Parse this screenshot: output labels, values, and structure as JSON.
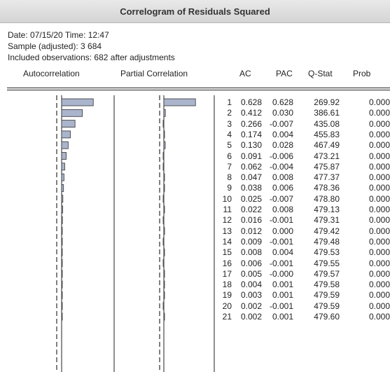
{
  "title": "Correlogram of Residuals Squared",
  "info": {
    "date_line": "Date: 07/15/20   Time: 12:47",
    "sample_line": "Sample (adjusted): 3 684",
    "obs_line": "Included observations: 682 after adjustments"
  },
  "headers": {
    "autocorrelation": "Autocorrelation",
    "partial_correlation": "Partial Correlation",
    "ac": "AC",
    "pac": "PAC",
    "qstat": "Q-Stat",
    "prob": "Prob"
  },
  "colors": {
    "bar_fill": "#aab4cc",
    "bar_stroke": "#333333",
    "confidence_line": "#000000"
  },
  "rows": [
    {
      "lag": "1",
      "ac": "0.628",
      "pac": "0.628",
      "q": "269.92",
      "prob": "0.000"
    },
    {
      "lag": "2",
      "ac": "0.412",
      "pac": "0.030",
      "q": "386.61",
      "prob": "0.000"
    },
    {
      "lag": "3",
      "ac": "0.266",
      "pac": "-0.007",
      "q": "435.08",
      "prob": "0.000"
    },
    {
      "lag": "4",
      "ac": "0.174",
      "pac": "0.004",
      "q": "455.83",
      "prob": "0.000"
    },
    {
      "lag": "5",
      "ac": "0.130",
      "pac": "0.028",
      "q": "467.49",
      "prob": "0.000"
    },
    {
      "lag": "6",
      "ac": "0.091",
      "pac": "-0.006",
      "q": "473.21",
      "prob": "0.000"
    },
    {
      "lag": "7",
      "ac": "0.062",
      "pac": "-0.004",
      "q": "475.87",
      "prob": "0.000"
    },
    {
      "lag": "8",
      "ac": "0.047",
      "pac": "0.008",
      "q": "477.37",
      "prob": "0.000"
    },
    {
      "lag": "9",
      "ac": "0.038",
      "pac": "0.006",
      "q": "478.36",
      "prob": "0.000"
    },
    {
      "lag": "10",
      "ac": "0.025",
      "pac": "-0.007",
      "q": "478.80",
      "prob": "0.000"
    },
    {
      "lag": "11",
      "ac": "0.022",
      "pac": "0.008",
      "q": "479.13",
      "prob": "0.000"
    },
    {
      "lag": "12",
      "ac": "0.016",
      "pac": "-0.001",
      "q": "479.31",
      "prob": "0.000"
    },
    {
      "lag": "13",
      "ac": "0.012",
      "pac": "0.000",
      "q": "479.42",
      "prob": "0.000"
    },
    {
      "lag": "14",
      "ac": "0.009",
      "pac": "-0.001",
      "q": "479.48",
      "prob": "0.000"
    },
    {
      "lag": "15",
      "ac": "0.008",
      "pac": "0.004",
      "q": "479.53",
      "prob": "0.000"
    },
    {
      "lag": "16",
      "ac": "0.006",
      "pac": "-0.001",
      "q": "479.55",
      "prob": "0.000"
    },
    {
      "lag": "17",
      "ac": "0.005",
      "pac": "-0.000",
      "q": "479.57",
      "prob": "0.000"
    },
    {
      "lag": "18",
      "ac": "0.004",
      "pac": "0.001",
      "q": "479.58",
      "prob": "0.000"
    },
    {
      "lag": "19",
      "ac": "0.003",
      "pac": "0.001",
      "q": "479.59",
      "prob": "0.000"
    },
    {
      "lag": "20",
      "ac": "0.002",
      "pac": "-0.001",
      "q": "479.59",
      "prob": "0.000"
    },
    {
      "lag": "21",
      "ac": "0.002",
      "pac": "0.001",
      "q": "479.60",
      "prob": "0.000"
    }
  ]
}
